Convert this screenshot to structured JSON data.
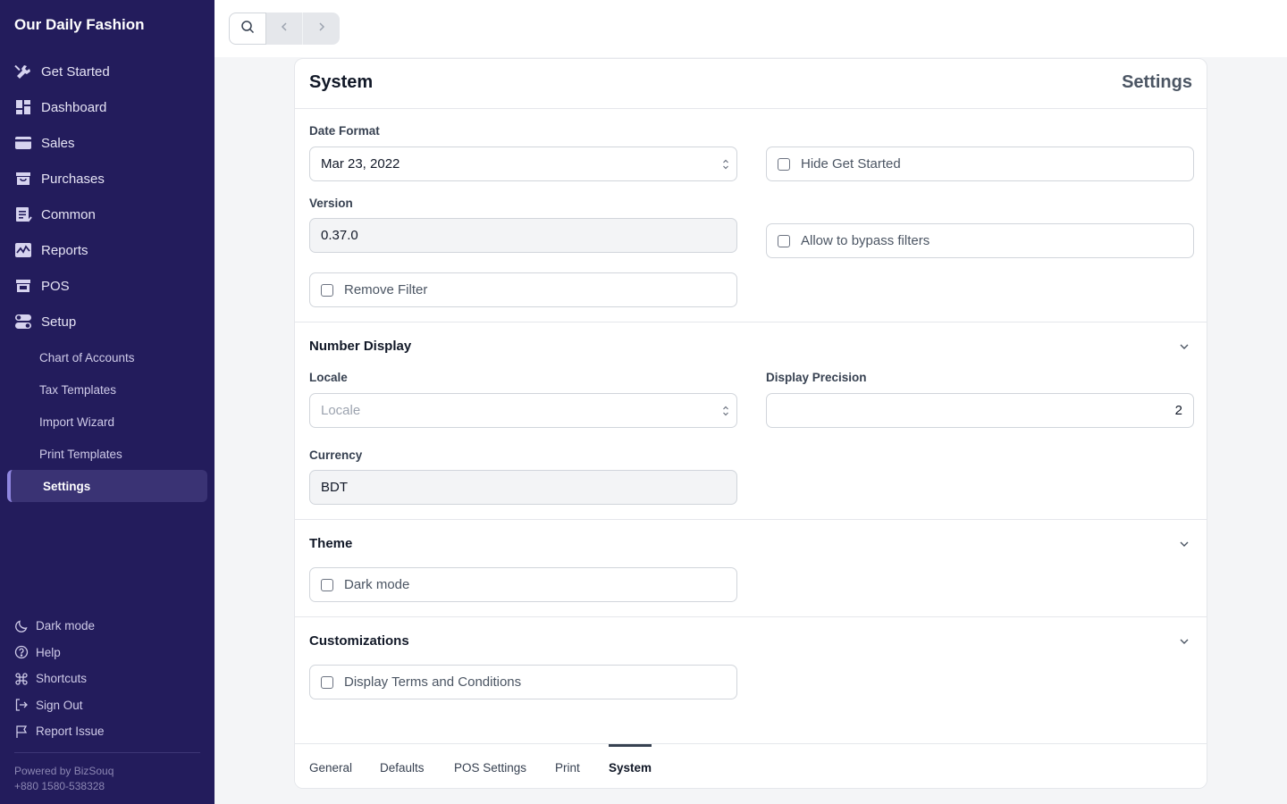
{
  "sidebar": {
    "brand": "Our Daily Fashion",
    "items": [
      {
        "label": "Get Started",
        "icon": "wrench-icon"
      },
      {
        "label": "Dashboard",
        "icon": "dashboard-icon"
      },
      {
        "label": "Sales",
        "icon": "card-icon"
      },
      {
        "label": "Purchases",
        "icon": "bag-icon"
      },
      {
        "label": "Common",
        "icon": "list-icon"
      },
      {
        "label": "Reports",
        "icon": "chart-icon"
      },
      {
        "label": "POS",
        "icon": "store-icon"
      },
      {
        "label": "Setup",
        "icon": "toggle-icon"
      }
    ],
    "setup_items": [
      "Chart of Accounts",
      "Tax Templates",
      "Import Wizard",
      "Print Templates",
      "Settings"
    ],
    "active_setup_item": "Settings",
    "bottom_links": [
      {
        "label": "Dark mode",
        "icon": "moon-icon"
      },
      {
        "label": "Help",
        "icon": "help-icon"
      },
      {
        "label": "Shortcuts",
        "icon": "command-icon"
      },
      {
        "label": "Sign Out",
        "icon": "sign-out-icon"
      },
      {
        "label": "Report Issue",
        "icon": "flag-icon"
      }
    ],
    "powered_by": "Powered by BizSouq",
    "phone": "+880 1580-538328",
    "colors": {
      "background": "#231c5c",
      "active_bg": "#3a3374",
      "active_border": "#8f86e0"
    }
  },
  "topbar": {
    "icons": [
      "search-icon",
      "chevron-left-icon",
      "chevron-right-icon"
    ]
  },
  "page": {
    "title": "System",
    "header_right": "Settings"
  },
  "system": {
    "date_format_label": "Date Format",
    "date_format_value": "Mar 23, 2022",
    "version_label": "Version",
    "version_value": "0.37.0",
    "remove_filter": "Remove Filter",
    "hide_get_started": "Hide Get Started",
    "allow_bypass": "Allow to bypass filters"
  },
  "number_display": {
    "title": "Number Display",
    "locale_label": "Locale",
    "locale_placeholder": "Locale",
    "precision_label": "Display Precision",
    "precision_value": "2",
    "currency_label": "Currency",
    "currency_value": "BDT"
  },
  "theme": {
    "title": "Theme",
    "dark_mode": "Dark mode"
  },
  "customizations": {
    "title": "Customizations",
    "display_terms": "Display Terms and Conditions"
  },
  "tabs": [
    "General",
    "Defaults",
    "POS Settings",
    "Print",
    "System"
  ],
  "active_tab": "System"
}
